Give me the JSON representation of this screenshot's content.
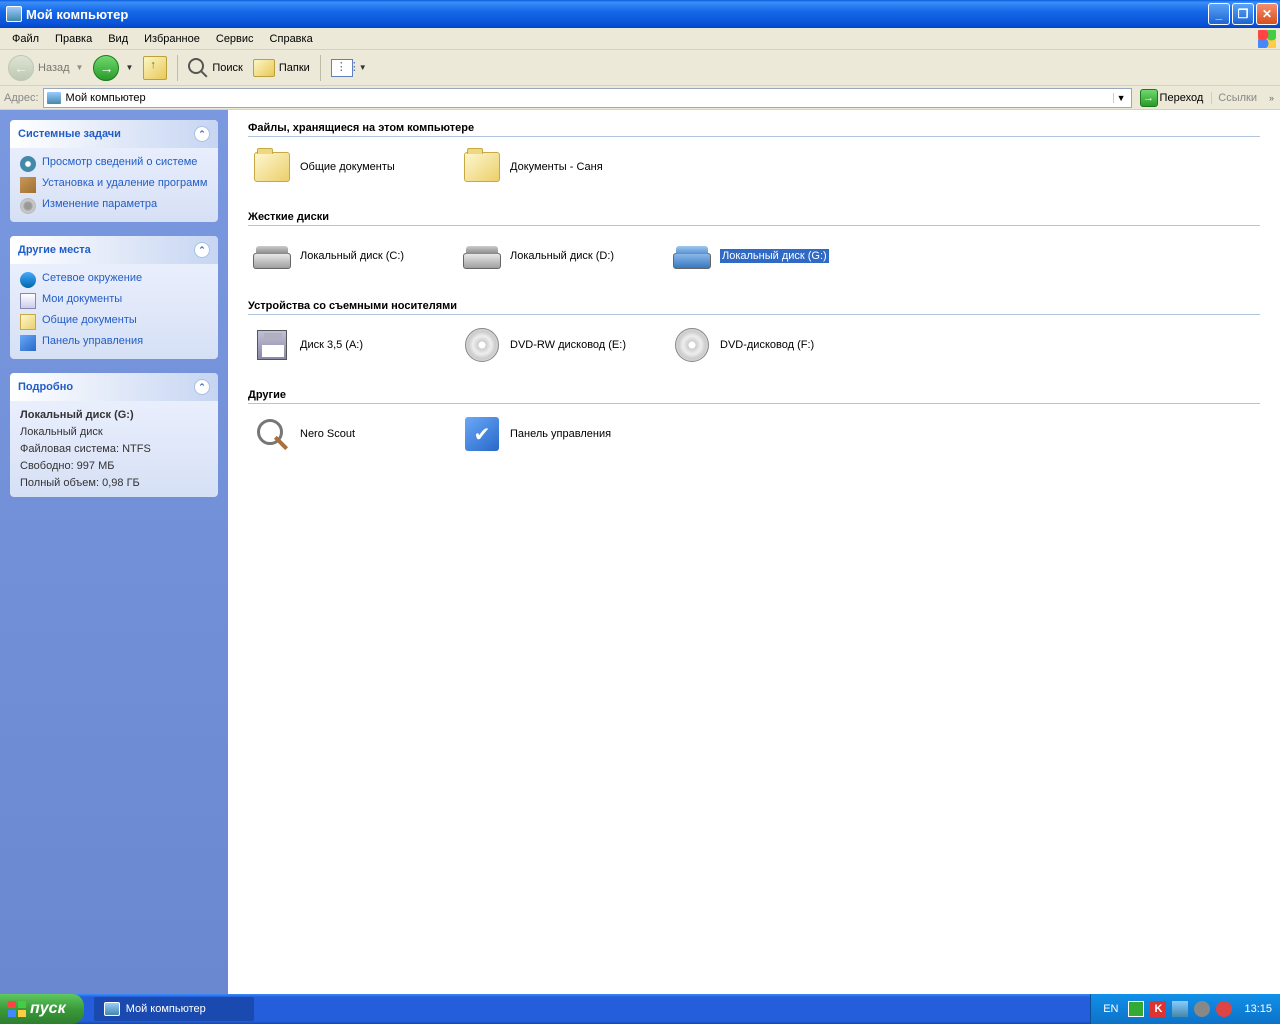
{
  "window": {
    "title": "Мой компьютер"
  },
  "menubar": [
    "Файл",
    "Правка",
    "Вид",
    "Избранное",
    "Сервис",
    "Справка"
  ],
  "toolbar": {
    "back": "Назад",
    "search": "Поиск",
    "folders": "Папки"
  },
  "addressbar": {
    "label": "Адрес:",
    "value": "Мой компьютер",
    "go": "Переход",
    "links": "Ссылки"
  },
  "sidebar": {
    "system": {
      "title": "Системные задачи",
      "items": [
        "Просмотр сведений о системе",
        "Установка и удаление программ",
        "Изменение параметра"
      ]
    },
    "places": {
      "title": "Другие места",
      "items": [
        "Сетевое окружение",
        "Мои документы",
        "Общие документы",
        "Панель управления"
      ]
    },
    "details": {
      "title": "Подробно",
      "name": "Локальный диск (G:)",
      "type": "Локальный диск",
      "fs": "Файловая система: NTFS",
      "free": "Свободно: 997 МБ",
      "total": "Полный объем: 0,98 ГБ"
    }
  },
  "groups": [
    {
      "header": "Файлы, хранящиеся на этом компьютере",
      "items": [
        {
          "label": "Общие документы",
          "icon": "folder"
        },
        {
          "label": "Документы - Саня",
          "icon": "folder"
        }
      ]
    },
    {
      "header": "Жесткие диски",
      "items": [
        {
          "label": "Локальный диск (C:)",
          "icon": "hdd"
        },
        {
          "label": "Локальный диск (D:)",
          "icon": "hdd"
        },
        {
          "label": "Локальный диск (G:)",
          "icon": "hdd-blue",
          "selected": true
        }
      ]
    },
    {
      "header": "Устройства со съемными носителями",
      "items": [
        {
          "label": "Диск 3,5 (A:)",
          "icon": "floppy"
        },
        {
          "label": "DVD-RW дисковод (E:)",
          "icon": "dvd"
        },
        {
          "label": "DVD-дисковод (F:)",
          "icon": "dvd"
        }
      ]
    },
    {
      "header": "Другие",
      "items": [
        {
          "label": "Nero Scout",
          "icon": "scout"
        },
        {
          "label": "Панель управления",
          "icon": "cpanel"
        }
      ]
    }
  ],
  "taskbar": {
    "start": "пуск",
    "task": "Мой компьютер",
    "lang": "EN",
    "time": "13:15"
  }
}
